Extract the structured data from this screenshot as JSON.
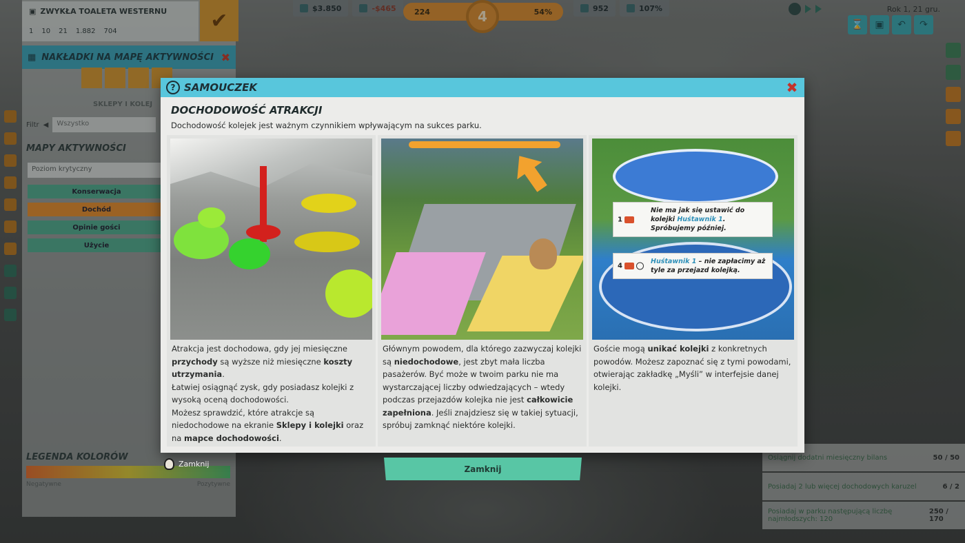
{
  "hud": {
    "money": "$3.850",
    "income": "-$465",
    "guests": "224",
    "center": "4",
    "rating": "54%",
    "stat1": "952",
    "stat2": "107%",
    "date": "Rok 1, 21 gru."
  },
  "info_box": {
    "title": "ZWYKŁA TOALETA WESTERNU",
    "stats": [
      "1",
      "10",
      "21",
      "1.882",
      "704"
    ]
  },
  "overlay_panel": {
    "title": "NAKŁADKI NA MAPĘ AKTYWNOŚCI",
    "section": "SKLEPY I KOLEJ",
    "filter_label": "Filtr",
    "filter_value": "Wszystko",
    "maps_title": "MAPY AKTYWNOŚCI",
    "critical": "Poziom krytyczny",
    "options": [
      "Konserwacja",
      "Dochód",
      "Opinie gości",
      "Użycie"
    ],
    "legend_title": "LEGENDA KOLORÓW",
    "legend_neg": "Negatywne",
    "legend_pos": "Pozytywne"
  },
  "objectives": [
    {
      "label": "Osiągnij dodatni miesięczny bilans",
      "value": "50 / 50"
    },
    {
      "label": "Posiadaj 2 lub więcej dochodowych karuzel",
      "value": "6 / 2"
    },
    {
      "label": "Posiadaj w parku następującą liczbę najmłodszych: 120",
      "value": "250 / 170"
    }
  ],
  "modal": {
    "header": "SAMOUCZEK",
    "title": "DOCHODOWOŚĆ ATRAKCJI",
    "intro": "Dochodowość kolejek jest ważnym czynnikiem wpływającym na sukces parku.",
    "close_label": "Zamknij",
    "key_hint": "Zamknij",
    "cards": [
      {
        "p1_a": "Atrakcja jest dochodowa, gdy jej miesięczne ",
        "p1_b": "przychody",
        "p1_c": " są wyższe niż miesięczne ",
        "p1_d": "koszty utrzymania",
        "p1_e": ".",
        "p2": "Łatwiej osiągnąć zysk, gdy posiadasz kolejki z wysoką oceną dochodowości.",
        "p3_a": "Możesz sprawdzić, które atrakcje są niedochodowe na ekranie ",
        "p3_b": "Sklepy i kolejki",
        "p3_c": " oraz na ",
        "p3_d": "mapce dochodowości",
        "p3_e": "."
      },
      {
        "a": "Głównym powodem, dla którego zazwyczaj kolejki są ",
        "b": "niedochodowe",
        "c": ", jest zbyt mała liczba pasażerów. Być może w twoim parku nie ma wystarczającej liczby odwiedzających – wtedy podczas przejazdów kolejka nie jest ",
        "d": "całkowicie zapełniona",
        "e": ". Jeśli znajdziesz się w takiej sytuacji, spróbuj zamknąć niektóre kolejki."
      },
      {
        "a": "Goście mogą ",
        "b": "unikać kolejki",
        "c": " z konkretnych powodów. Możesz zapoznać się z tymi powodami, otwierając zakładkę „Myśli” w interfejsie danej kolejki.",
        "tip1_num": "1",
        "tip1_a": "Nie ma jak się ustawić do kolejki ",
        "tip1_ride": "Huśtawnik 1",
        "tip1_b": ". Spróbujemy później.",
        "tip2_num": "4",
        "tip2_ride": "Huśtawnik 1",
        "tip2_b": " – nie zapłacimy aż tyle za przejazd kolejką."
      }
    ]
  }
}
